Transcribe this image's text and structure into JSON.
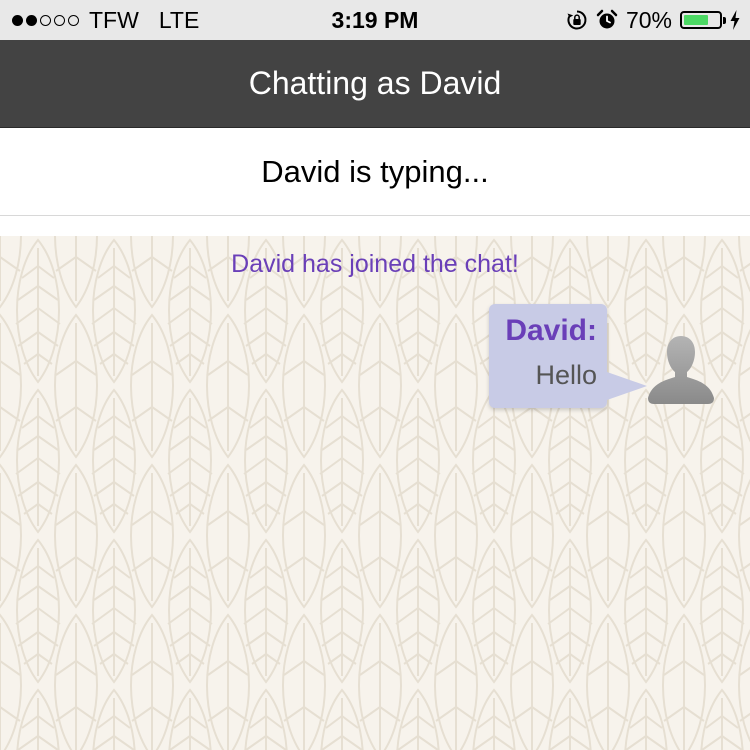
{
  "status_bar": {
    "signal_filled": 2,
    "signal_total": 5,
    "carrier": "TFW",
    "network": "LTE",
    "time": "3:19 PM",
    "battery_text": "70%",
    "battery_level": 0.7,
    "icons": [
      "rotation-lock-icon",
      "alarm-icon",
      "battery-icon",
      "charging-bolt-icon"
    ]
  },
  "nav": {
    "title": "Chatting as David"
  },
  "typing": {
    "text": "David is typing..."
  },
  "chat": {
    "system_message": "David has joined the chat!",
    "messages": [
      {
        "sender": "David:",
        "text": "Hello",
        "avatar": "person-silhouette-icon"
      }
    ]
  },
  "colors": {
    "nav_background": "#434343",
    "accent_purple": "#6a3fb8",
    "bubble_background": "#c8cbe6",
    "battery_green": "#4cd964",
    "chat_background": "#f7f3ec"
  }
}
